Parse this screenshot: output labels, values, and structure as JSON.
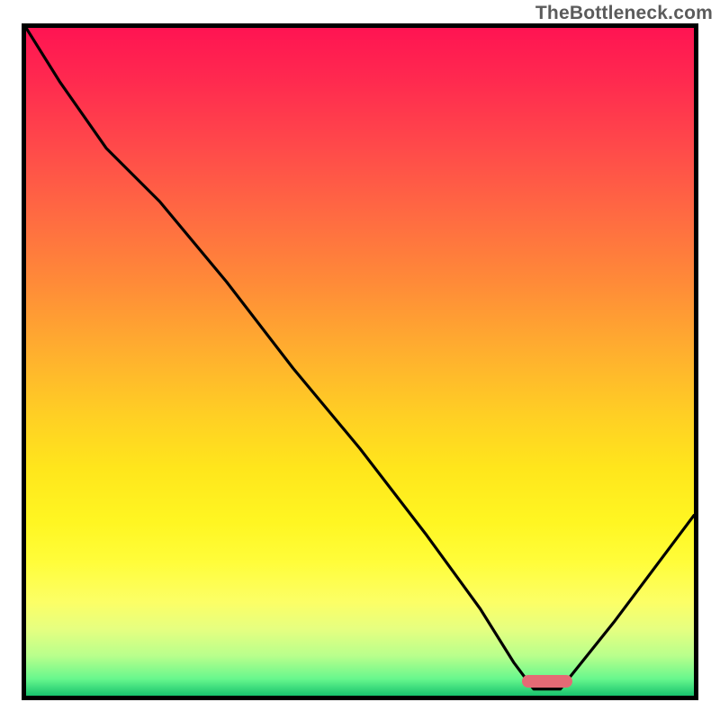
{
  "attribution": "TheBottleneck.com",
  "colors": {
    "curve": "#000000",
    "marker": "#e46a75"
  },
  "chart_data": {
    "type": "line",
    "title": "",
    "xlabel": "",
    "ylabel": "",
    "xlim": [
      0,
      100
    ],
    "ylim": [
      0,
      100
    ],
    "grid": false,
    "legend": false,
    "note": "Axes are unlabeled; values are read as percentages of plot width/height. y=100 at top edge, y=0 at bottom edge. Curve descends from top-left, flattens at the bottom near x≈78, then rises toward the right edge. A pink lozenge marks the flat minimum.",
    "series": [
      {
        "name": "bottleneck-curve",
        "x": [
          0,
          5,
          12,
          20,
          30,
          40,
          50,
          60,
          68,
          73,
          76,
          80,
          88,
          100
        ],
        "y": [
          100,
          92,
          82,
          74,
          62,
          49,
          37,
          24,
          13,
          5,
          1,
          1,
          11,
          27
        ]
      }
    ],
    "marker": {
      "x_center": 78,
      "y": 2.2,
      "width_pct": 7.5,
      "height_pct": 1.9
    }
  }
}
